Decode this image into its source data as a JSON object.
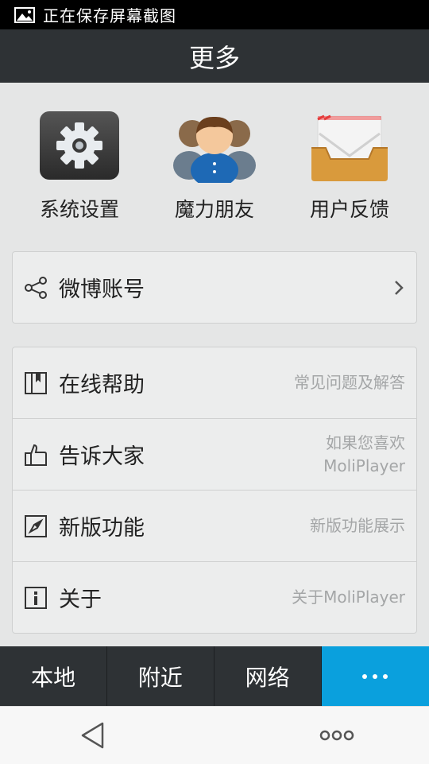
{
  "status_bar": {
    "text": "正在保存屏幕截图",
    "icon": "image-icon"
  },
  "header": {
    "title": "更多"
  },
  "grid": [
    {
      "label": "系统设置",
      "icon": "gear-icon"
    },
    {
      "label": "魔力朋友",
      "icon": "friends-icon"
    },
    {
      "label": "用户反馈",
      "icon": "mail-tray-icon"
    }
  ],
  "weibo": {
    "label": "微博账号",
    "icon": "share-icon"
  },
  "list": [
    {
      "label": "在线帮助",
      "sub": "常见问题及解答",
      "icon": "book-icon"
    },
    {
      "label": "告诉大家",
      "sub": "如果您喜欢MoliPlayer",
      "icon": "thumbs-up-icon"
    },
    {
      "label": "新版功能",
      "sub": "新版功能展示",
      "icon": "compass-icon"
    },
    {
      "label": "关于",
      "sub": "关于MoliPlayer",
      "icon": "info-icon"
    }
  ],
  "tabs": [
    {
      "label": "本地"
    },
    {
      "label": "附近"
    },
    {
      "label": "网络"
    },
    {
      "label": "",
      "icon": "more-dots-icon",
      "active": true
    }
  ],
  "colors": {
    "accent": "#0aa0dd",
    "header_bg": "#2e3235",
    "bg": "#e5e6e6"
  }
}
